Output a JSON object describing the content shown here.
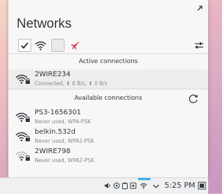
{
  "popup": {
    "title": "Networks"
  },
  "sections": {
    "active": "Active connections",
    "available": "Available connections"
  },
  "active_connections": [
    {
      "name": "2WIRE234",
      "detail": "Connected, ⬇ 0 B/s, ⬆ 0 B/s"
    }
  ],
  "available_connections": [
    {
      "name": "PS3-1656301",
      "detail": "Never used, WPA-PSK"
    },
    {
      "name": "belkin.532d",
      "detail": "Never used, WPA2-PSK"
    },
    {
      "name": "2WIRE798",
      "detail": "Never used, WPA2-PSK"
    }
  ],
  "taskbar": {
    "clock": "5:25 PM"
  },
  "colors": {
    "accent": "#3daee9",
    "plane": "#da4453",
    "text": "#31363b"
  }
}
